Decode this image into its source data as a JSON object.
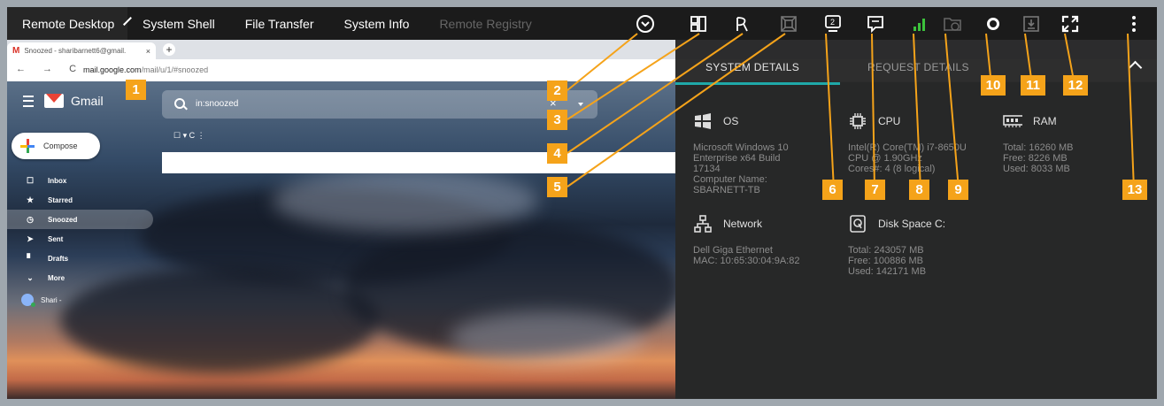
{
  "toolbar": {
    "tabs": [
      "Remote Desktop",
      "System Shell",
      "File Transfer",
      "System Info",
      "Remote Registry"
    ],
    "screen_number": "2"
  },
  "browser": {
    "tab_title": "Snoozed - sharibarnett6@gmail.",
    "tab_close": "×",
    "new_tab": "+",
    "nav_buttons": "← → C",
    "url_host": "mail.google.com",
    "url_path": "/mail/u/1/#snoozed"
  },
  "gmail": {
    "brand": "Gmail",
    "search_query": "in:snoozed",
    "search_clear": "×",
    "compose_label": "Compose",
    "list_tools": "☐ ▾   C   ⋮",
    "nav": [
      {
        "icon": "☐",
        "label": "Inbox"
      },
      {
        "icon": "★",
        "label": "Starred"
      },
      {
        "icon": "◷",
        "label": "Snoozed"
      },
      {
        "icon": "➤",
        "label": "Sent"
      },
      {
        "icon": "▘",
        "label": "Drafts"
      },
      {
        "icon": "⌄",
        "label": "More"
      }
    ],
    "account_label": "Shari -"
  },
  "panel": {
    "tab_system": "SYSTEM DETAILS",
    "tab_request": "REQUEST DETAILS",
    "os": {
      "title": "OS",
      "lines": [
        "Microsoft Windows 10",
        "Enterprise x64 Build",
        "17134",
        "Computer Name:",
        "SBARNETT-TB"
      ]
    },
    "cpu": {
      "title": "CPU",
      "lines": [
        "Intel(R) Core(TM) i7-8650U",
        "CPU @ 1.90GHz",
        "Cores#: 4 (8 logical)"
      ]
    },
    "ram": {
      "title": "RAM",
      "lines": [
        "Total: 16260 MB",
        "Free: 8226 MB",
        "Used: 8033 MB"
      ]
    },
    "network": {
      "title": "Network",
      "lines": [
        "Dell Giga Ethernet",
        "MAC: 10:65:30:04:9A:82"
      ]
    },
    "disk": {
      "title": "Disk Space C:",
      "lines": [
        "Total: 243057 MB",
        "Free: 100886 MB",
        "Used: 142171 MB"
      ]
    }
  },
  "callouts": [
    "1",
    "2",
    "3",
    "4",
    "5",
    "6",
    "7",
    "8",
    "9",
    "10",
    "11",
    "12",
    "13"
  ],
  "colors": {
    "accent": "#1fa8a8",
    "badge": "#f5a31a",
    "signal": "#3cc23c"
  }
}
